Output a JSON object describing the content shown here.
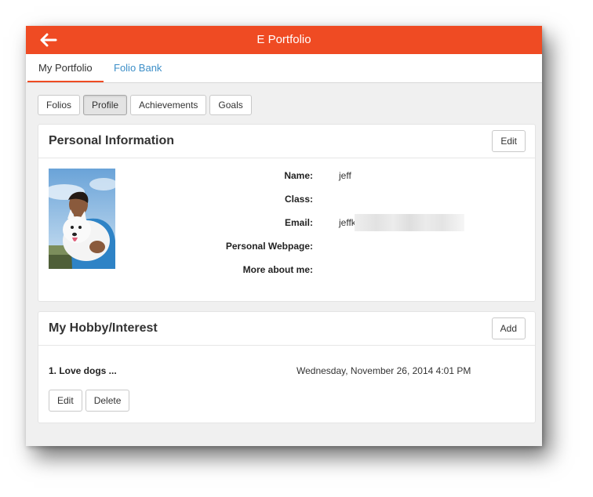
{
  "app": {
    "title": "E Portfolio",
    "accent_color": "#ef4b23"
  },
  "icons": {
    "back": "back-arrow-icon"
  },
  "tabs": [
    {
      "label": "My Portfolio",
      "active": true
    },
    {
      "label": "Folio Bank",
      "active": false
    }
  ],
  "segments": [
    {
      "label": "Folios",
      "active": false
    },
    {
      "label": "Profile",
      "active": true
    },
    {
      "label": "Achievements",
      "active": false
    },
    {
      "label": "Goals",
      "active": false
    }
  ],
  "personal_info": {
    "title": "Personal Information",
    "edit_label": "Edit",
    "fields": [
      {
        "label": "Name:",
        "value": "jeff"
      },
      {
        "label": "Class:",
        "value": ""
      },
      {
        "label": "Email:",
        "value": "jeffk"
      },
      {
        "label": "Personal Webpage:",
        "value": ""
      },
      {
        "label": "More about me:",
        "value": ""
      }
    ]
  },
  "hobby": {
    "title": "My Hobby/Interest",
    "add_label": "Add",
    "items": [
      {
        "name": "1. Love dogs ...",
        "date": "Wednesday, November 26, 2014 4:01 PM"
      }
    ],
    "edit_label": "Edit",
    "delete_label": "Delete"
  }
}
